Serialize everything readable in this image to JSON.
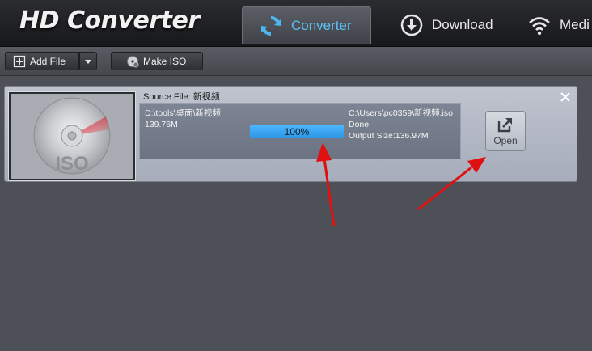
{
  "header": {
    "app_title": "HD Converter",
    "tabs": [
      {
        "label": "Converter",
        "icon": "refresh-icon",
        "active": true
      },
      {
        "label": "Download",
        "icon": "download-icon",
        "active": false
      },
      {
        "label": "Medi",
        "icon": "wifi-icon",
        "active": false
      }
    ]
  },
  "toolbar": {
    "add_file_label": "Add File",
    "make_iso_label": "Make ISO"
  },
  "task": {
    "source_label": "Source File: 新视频",
    "source_path": "D:\\tools\\桌面\\新视频",
    "source_size": "139.76M",
    "progress_text": "100%",
    "progress_value": 1.0,
    "output_path": "C:\\Users\\pc0359\\新视频.iso",
    "status": "Done",
    "output_size": "Output Size:136.97M",
    "open_label": "Open",
    "thumb_label": "ISO"
  },
  "colors": {
    "accent": "#5ec0f5",
    "progress": "#3aa6f2",
    "annotation_arrow": "#e01010"
  }
}
